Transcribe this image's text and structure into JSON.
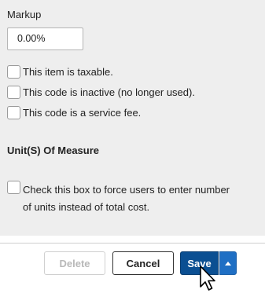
{
  "markup": {
    "label": "Markup",
    "value": "0.00%"
  },
  "options": [
    {
      "label": "This item is taxable.",
      "checked": false
    },
    {
      "label": "This code is inactive (no longer used).",
      "checked": false
    },
    {
      "label": "This code is a service fee.",
      "checked": false
    }
  ],
  "units_section": {
    "title": "Unit(S) Of Measure",
    "force_units_line1": "Check this box to force users to enter number",
    "force_units_line2": "of units instead of total cost.",
    "checked": false
  },
  "footer": {
    "delete_label": "Delete",
    "cancel_label": "Cancel",
    "save_label": "Save",
    "save_menu_icon": "caret-up-icon"
  },
  "colors": {
    "save_primary": "#0b4f92",
    "save_split": "#1f6fc4",
    "panel_bg": "#eeeeee"
  }
}
